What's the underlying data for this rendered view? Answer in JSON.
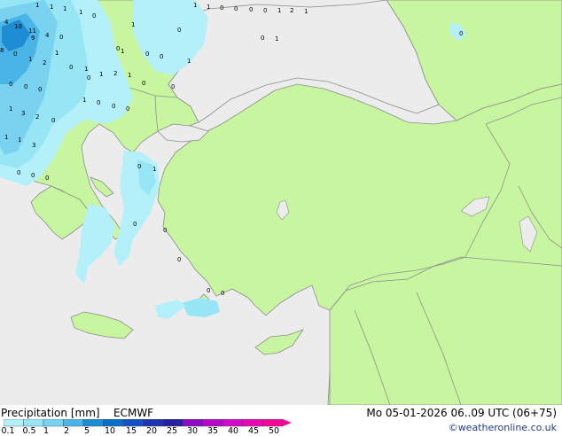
{
  "footer": {
    "title": "Precipitation [mm]",
    "model": "ECMWF",
    "datetime": "Mo 05-01-2026 06..09 UTC (06+75)",
    "credit": "©weatheronline.co.uk"
  },
  "legend": {
    "ticks": [
      "0.1",
      "0.5",
      "1",
      "2",
      "5",
      "10",
      "15",
      "20",
      "25",
      "30",
      "35",
      "40",
      "45",
      "50"
    ],
    "colors": [
      "#b4f0fa",
      "#96e6f5",
      "#78d2f0",
      "#4bb4e6",
      "#1e8cd2",
      "#0a6ec8",
      "#1450c8",
      "#1e32b4",
      "#281ea0",
      "#8c0ac8",
      "#b40ac8",
      "#d20ac8",
      "#e60ab4",
      "#f00a96"
    ]
  },
  "map_colors": {
    "sea": "#ececec",
    "land": "#c8f5a0",
    "border": "#909090",
    "coast": "#8c8c8c"
  },
  "precip_values": [
    "1",
    "1",
    "1",
    "1",
    "1",
    "1",
    "0",
    "0",
    "0",
    "0",
    "1",
    "2",
    "1",
    "4",
    "10",
    "11",
    "8",
    "0",
    "4",
    "9",
    "0",
    "0",
    "1",
    "2",
    "1",
    "0",
    "1",
    "0",
    "1",
    "2",
    "1",
    "0",
    "1",
    "1",
    "0",
    "0",
    "0",
    "0",
    "1",
    "0",
    "0",
    "1",
    "0",
    "0",
    "0",
    "0",
    "1",
    "3",
    "2",
    "3",
    "0",
    "1",
    "1",
    "0",
    "0",
    "0",
    "1",
    "0",
    "0",
    "0",
    "0",
    "1",
    "0",
    "0",
    "0",
    "0",
    "0"
  ]
}
